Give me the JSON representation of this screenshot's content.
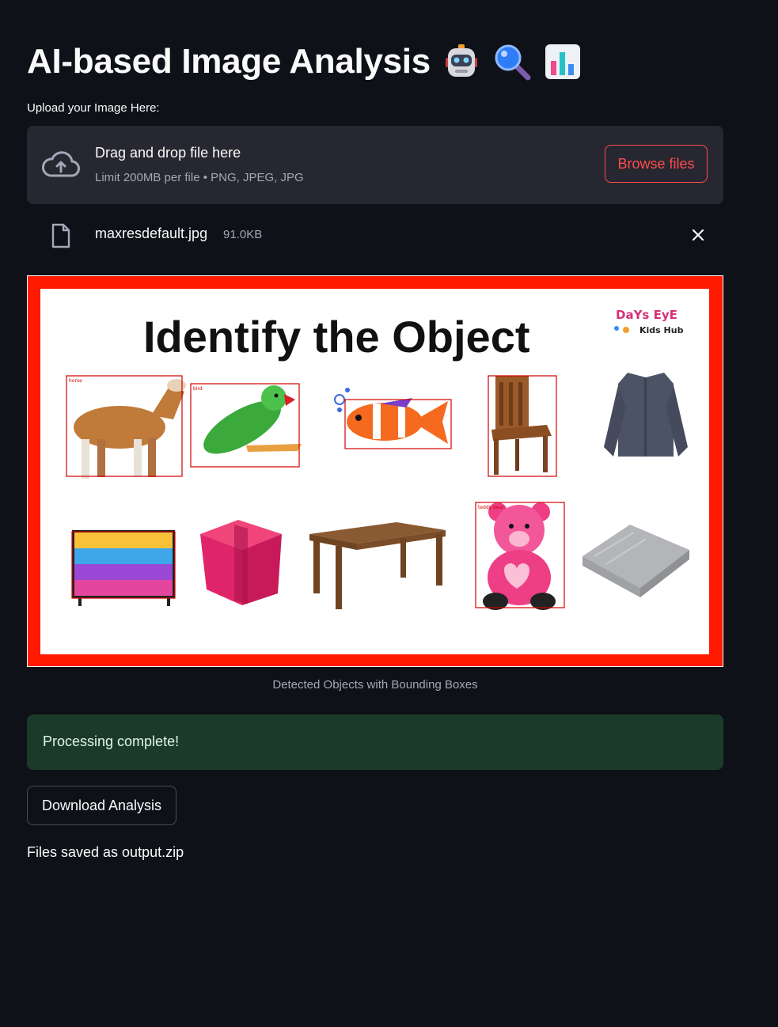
{
  "header": {
    "title": "AI-based Image Analysis",
    "emojis": [
      "robot-emoji",
      "magnifier-emoji",
      "bar-chart-emoji"
    ]
  },
  "uploader": {
    "label": "Upload your Image Here:",
    "drop_title": "Drag and drop file here",
    "drop_subtitle": "Limit 200MB per file • PNG, JPEG, JPG",
    "browse_label": "Browse files"
  },
  "file": {
    "name": "maxresdefault.jpg",
    "size": "91.0KB"
  },
  "image": {
    "heading": "Identify the Object",
    "logo_brand": "DaYs EyE",
    "logo_sub": "Kids Hub",
    "detections": [
      {
        "label": "horse"
      },
      {
        "label": "bird"
      },
      {
        "label": ""
      },
      {
        "label": ""
      },
      {
        "label": ""
      },
      {
        "label": "teddy bear"
      }
    ],
    "caption": "Detected Objects with Bounding Boxes"
  },
  "status": {
    "message": "Processing complete!"
  },
  "actions": {
    "download_label": "Download Analysis",
    "saved_text": "Files saved as output.zip"
  },
  "colors": {
    "background": "#0e1117",
    "accent": "#ff4b4b",
    "frame": "#ff1a00",
    "success_bg": "#1c3a2a"
  }
}
